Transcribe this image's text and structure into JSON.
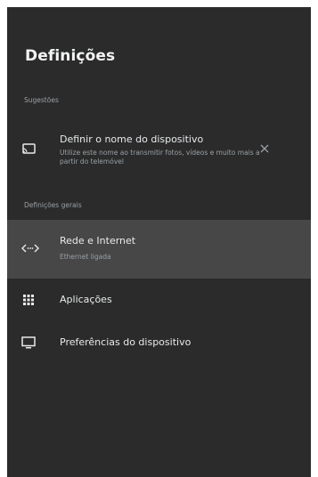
{
  "page_title": "Definições",
  "suggestions": {
    "header": "Sugestões",
    "items": [
      {
        "label": "Definir o nome do dispositivo",
        "description": "Utilize este nome ao transmitir fotos, vídeos e muito mais a partir do telemóvel",
        "icon": "cast-icon",
        "dismiss_icon": "close-icon"
      }
    ]
  },
  "general": {
    "header": "Definições gerais",
    "items": [
      {
        "label": "Rede e Internet",
        "description": "Ethernet ligada",
        "icon": "network-icon",
        "selected": true
      },
      {
        "label": "Aplicações",
        "icon": "apps-grid-icon"
      },
      {
        "label": "Preferências do dispositivo",
        "icon": "tv-icon"
      }
    ]
  },
  "colors": {
    "panel_background": "#2b2b2b",
    "selected_row": "#474747",
    "primary_text": "#e8eaed",
    "secondary_text": "#9aa0a6"
  }
}
